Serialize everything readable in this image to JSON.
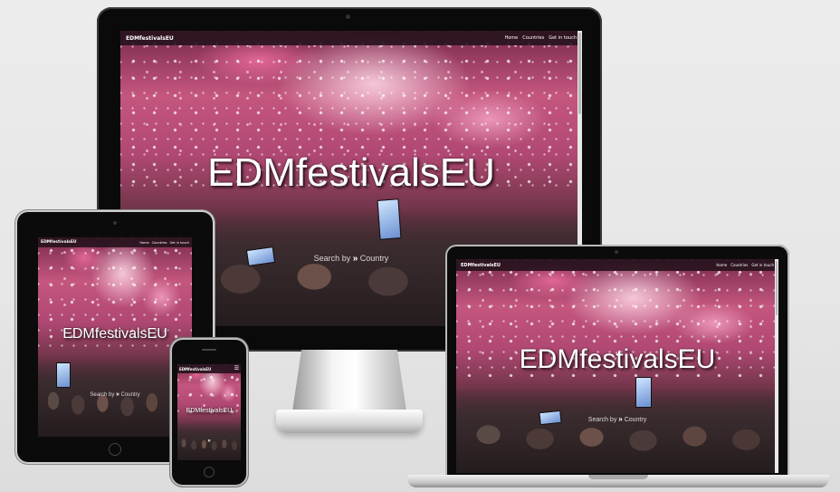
{
  "brand": "EDMfestivalsEU",
  "nav": [
    "Home",
    "Countries",
    "Get in touch"
  ],
  "hero_title": "EDMfestivalsEU",
  "search_prefix": "Search by",
  "search_label": "Country",
  "devices": [
    "desktop-monitor",
    "tablet",
    "phone",
    "laptop"
  ],
  "icons": {
    "chevron": "double-chevron-down-icon",
    "menu": "hamburger-menu-icon",
    "home": "home-button-icon"
  },
  "colors": {
    "navbar": "#2a1420",
    "bezel": "#0a0a0a",
    "accent_pink": "#c4567f"
  }
}
